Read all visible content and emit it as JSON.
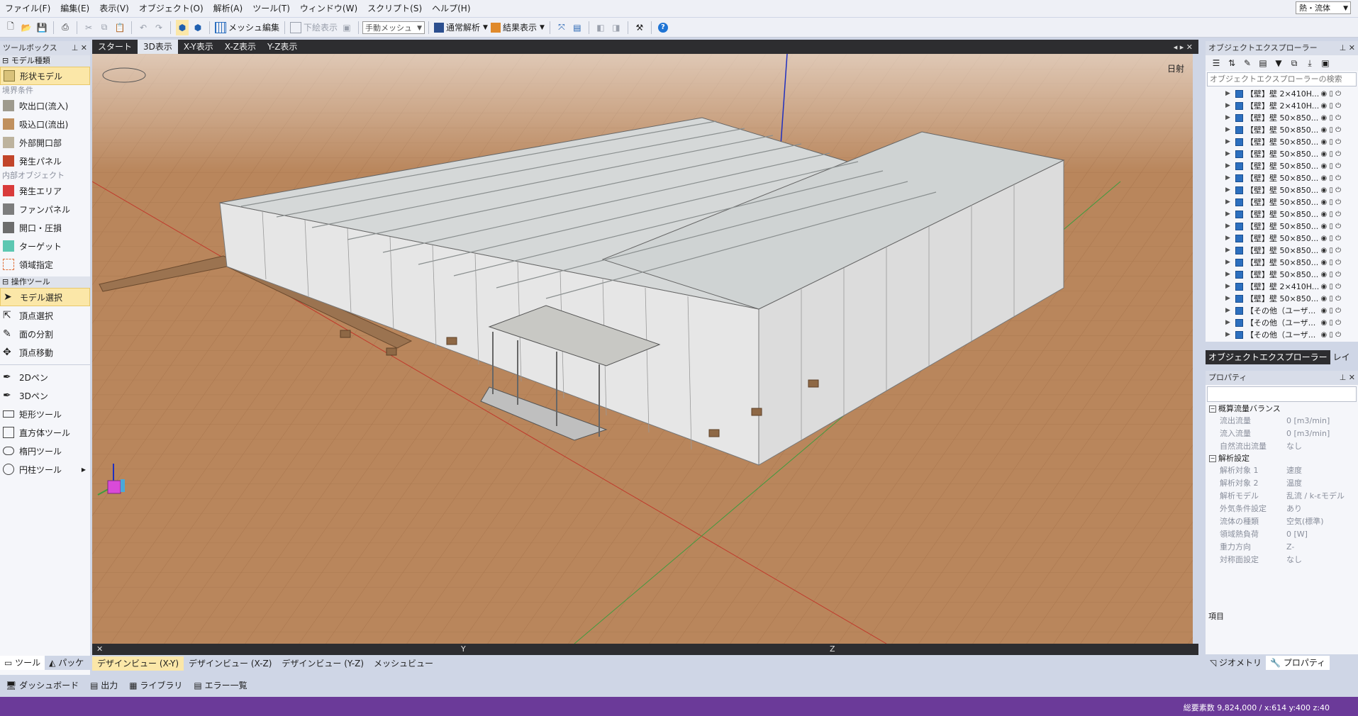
{
  "menubar": {
    "items": [
      "ファイル(F)",
      "編集(E)",
      "表示(V)",
      "オブジェクト(O)",
      "解析(A)",
      "ツール(T)",
      "ウィンドウ(W)",
      "スクリプト(S)",
      "ヘルプ(H)"
    ],
    "mode_select": "熱・流体"
  },
  "toolbar": {
    "mesh_edit": "メッシュ編集",
    "underlay": "下絵表示",
    "mesh_mode": "手動メッシュ",
    "analysis": "通常解析",
    "results": "結果表示"
  },
  "toolbox": {
    "title": "ツールボックス",
    "model_group": "モデル種類",
    "shape_model": "形状モデル",
    "boundary_group": "境界条件",
    "boundary_items": [
      "吹出口(流入)",
      "吸込口(流出)",
      "外部開口部",
      "発生パネル"
    ],
    "internal_group": "内部オブジェクト",
    "internal_items": [
      "発生エリア",
      "ファンパネル",
      "開口・圧損",
      "ターゲット",
      "領域指定"
    ],
    "ops_group": "操作ツール",
    "ops_items": [
      "モデル選択",
      "頂点選択",
      "面の分割",
      "頂点移動"
    ],
    "draw_items": [
      "2Dペン",
      "3Dペン",
      "矩形ツール",
      "直方体ツール",
      "楕円ツール",
      "円柱ツール"
    ],
    "tabs": [
      "ツール",
      "パッケ"
    ]
  },
  "view_tabs": [
    "スタート",
    "3D表示",
    "X-Y表示",
    "X-Z表示",
    "Y-Z表示"
  ],
  "viewport": {
    "sunlight": "日射",
    "axis_labels": [
      "Y",
      "Z"
    ]
  },
  "bottom_tabs": [
    "デザインビュー (X-Y)",
    "デザインビュー (X-Z)",
    "デザインビュー (Y-Z)",
    "メッシュビュー"
  ],
  "dash_tabs": [
    "ダッシュボード",
    "出力",
    "ライブラリ",
    "エラー一覧"
  ],
  "status": "総要素数 9,824,000 / x:614 y:400 z:40",
  "explorer": {
    "title": "オブジェクトエクスプローラー",
    "search_placeholder": "オブジェクトエクスプローラーの検索",
    "rows": [
      "【壁】壁 2×410H...",
      "【壁】壁 2×410H...",
      "【壁】壁 50×850...",
      "【壁】壁 50×850...",
      "【壁】壁 50×850...",
      "【壁】壁 50×850...",
      "【壁】壁 50×850...",
      "【壁】壁 50×850...",
      "【壁】壁 50×850...",
      "【壁】壁 50×850...",
      "【壁】壁 50×850...",
      "【壁】壁 50×850...",
      "【壁】壁 50×850...",
      "【壁】壁 50×850...",
      "【壁】壁 50×850...",
      "【壁】壁 50×850...",
      "【壁】壁 2×410H...",
      "【壁】壁 50×850...",
      "【その他（ユーザ...",
      "【その他（ユーザ...",
      "【その他（ユーザ..."
    ],
    "tabs": [
      "オブジェクトエクスプローラー",
      "レイ"
    ]
  },
  "properties": {
    "title": "プロパティ",
    "group1": "概算流量バランス",
    "group1_rows": [
      {
        "k": "流出流量",
        "v": "0 [m3/min]"
      },
      {
        "k": "流入流量",
        "v": "0 [m3/min]"
      },
      {
        "k": "自然流出流量",
        "v": "なし"
      }
    ],
    "group2": "解析設定",
    "group2_rows": [
      {
        "k": "解析対象 1",
        "v": "速度"
      },
      {
        "k": "解析対象 2",
        "v": "温度"
      },
      {
        "k": "解析モデル",
        "v": "乱流 / k-εモデル"
      },
      {
        "k": "外気条件設定",
        "v": "あり"
      },
      {
        "k": "流体の種類",
        "v": "空気(標準)"
      },
      {
        "k": "領域熱負荷",
        "v": "0 [W]"
      },
      {
        "k": "重力方向",
        "v": "Z-"
      },
      {
        "k": "対称面設定",
        "v": "なし"
      }
    ],
    "footer_label": "項目",
    "tabs": [
      "ジオメトリ",
      "プロパティ"
    ]
  }
}
